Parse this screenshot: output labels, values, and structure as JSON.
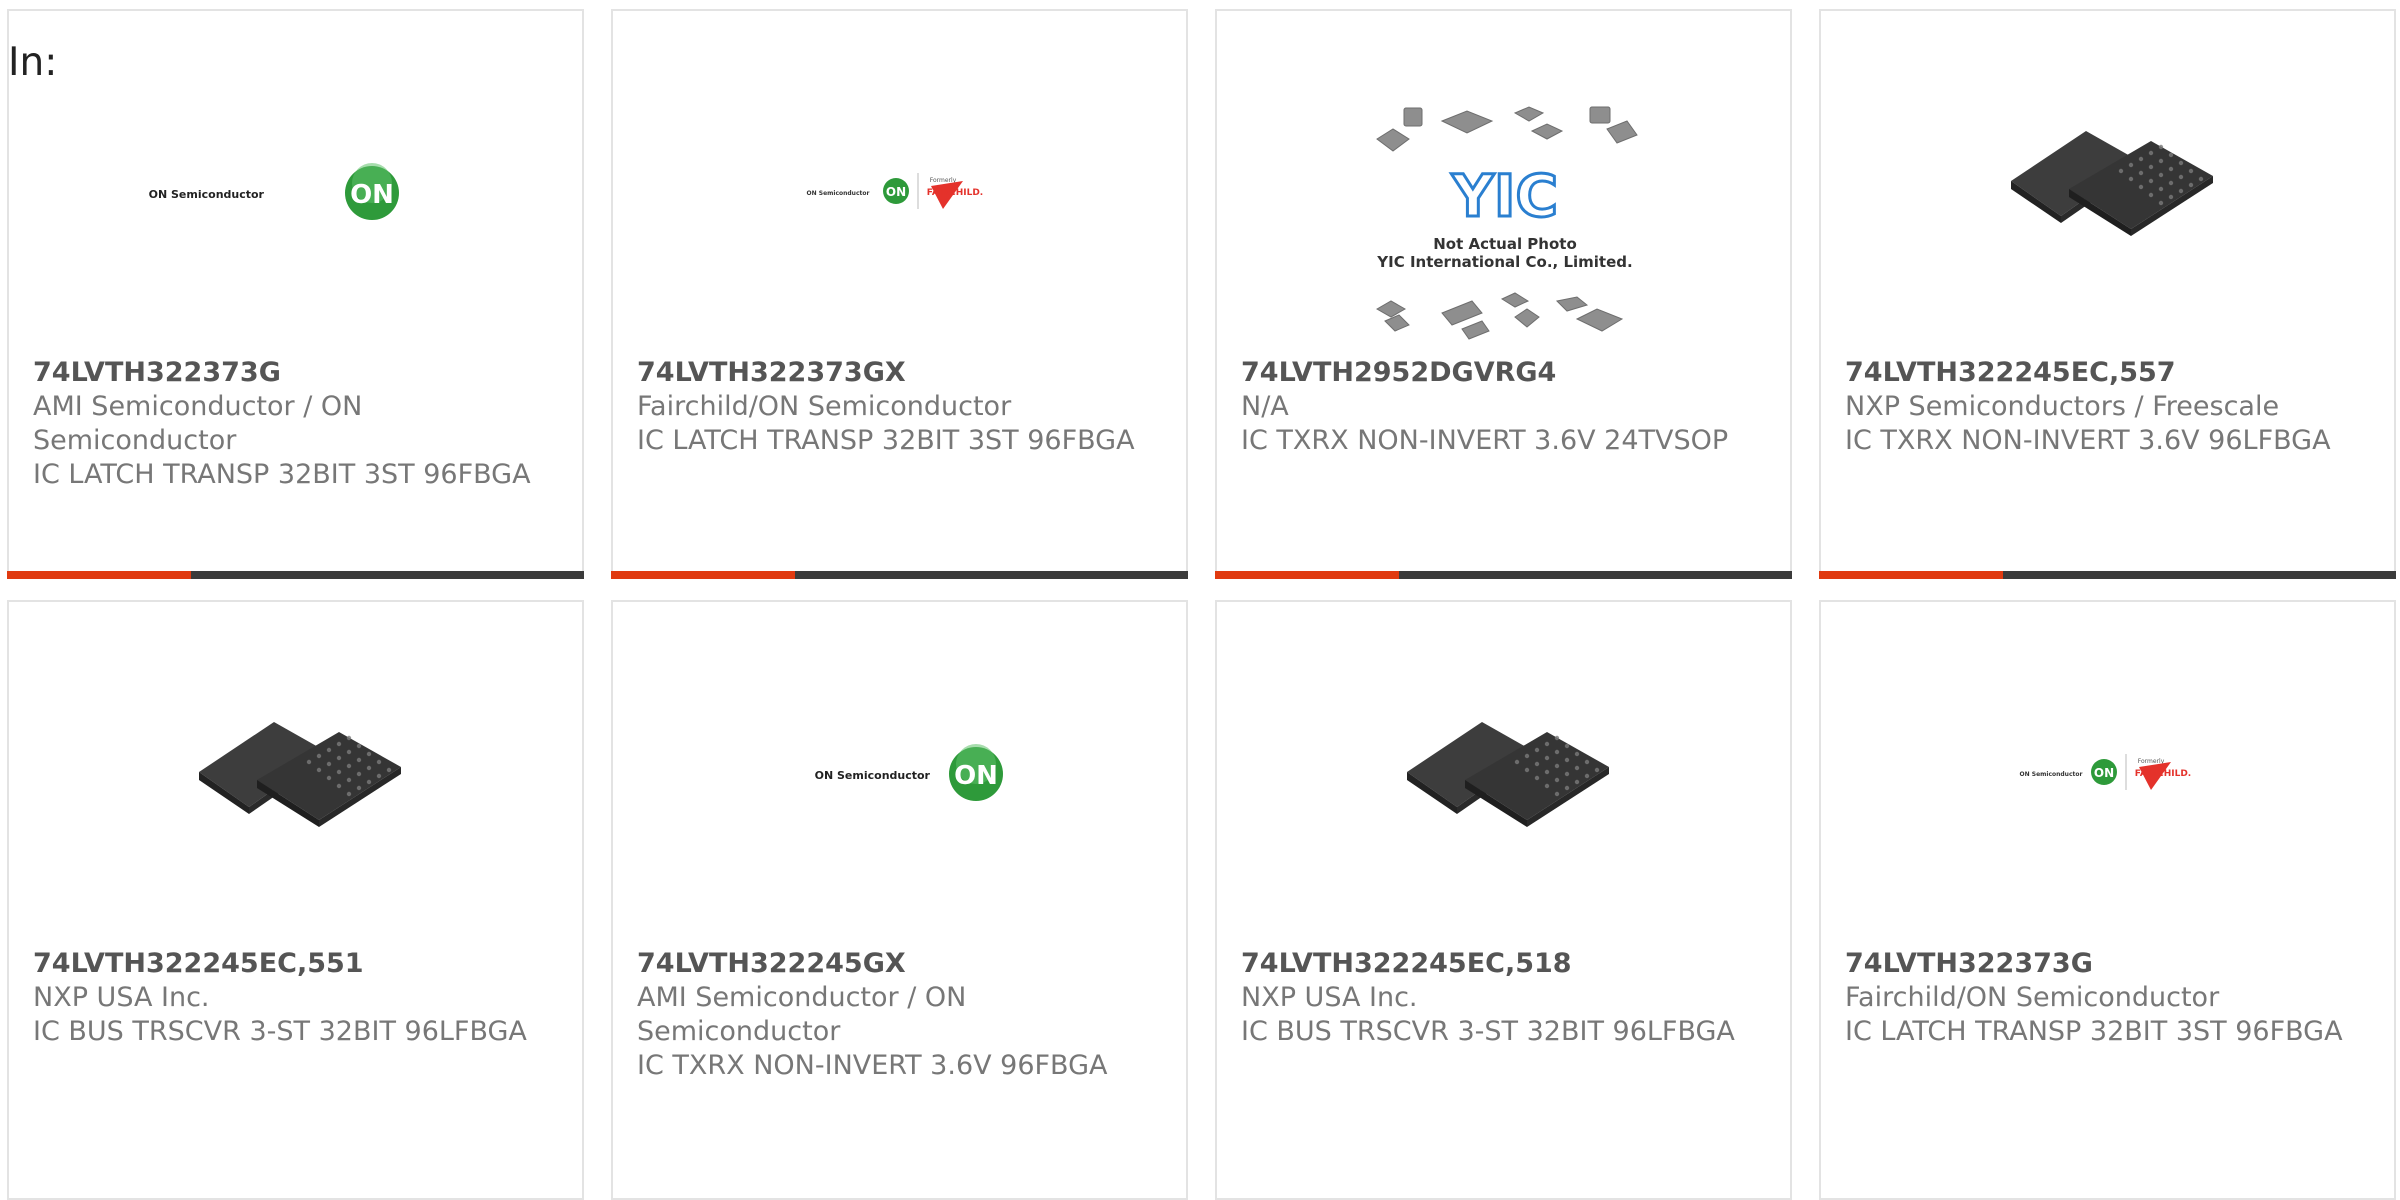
{
  "header": {
    "label": "In:"
  },
  "products": [
    {
      "part": "74LVTH322373G",
      "maker": "AMI Semiconductor / ON Semiconductor",
      "desc": "IC LATCH TRANSP 32BIT 3ST 96FBGA",
      "image": "on-semi-logo"
    },
    {
      "part": "74LVTH322373GX",
      "maker": "Fairchild/ON Semiconductor",
      "desc": "IC LATCH TRANSP 32BIT 3ST 96FBGA",
      "image": "on-fairchild-logo"
    },
    {
      "part": "74LVTH2952DGVRG4",
      "maker": "N/A",
      "desc": "IC TXRX NON-INVERT 3.6V 24TVSOP",
      "image": "not-actual-photo"
    },
    {
      "part": "74LVTH322245EC,557",
      "maker": "NXP Semiconductors / Freescale",
      "desc": "IC TXRX NON-INVERT 3.6V 96LFBGA",
      "image": "bga-chip"
    },
    {
      "part": "74LVTH322245EC,551",
      "maker": "NXP USA Inc.",
      "desc": "IC BUS TRSCVR 3-ST 32BIT 96LFBGA",
      "image": "bga-chip"
    },
    {
      "part": "74LVTH322245GX",
      "maker": "AMI Semiconductor / ON Semiconductor",
      "desc": "IC TXRX NON-INVERT 3.6V 96FBGA",
      "image": "on-semi-logo"
    },
    {
      "part": "74LVTH322245EC,518",
      "maker": "NXP USA Inc.",
      "desc": "IC BUS TRSCVR 3-ST 32BIT 96LFBGA",
      "image": "bga-chip"
    },
    {
      "part": "74LVTH322373G",
      "maker": "Fairchild/ON Semiconductor",
      "desc": "IC LATCH TRANSP 32BIT 3ST 96FBGA",
      "image": "on-fairchild-logo"
    }
  ],
  "logos": {
    "on_name": "ON Semiconductor",
    "on_mark": "ON",
    "formerly": "Formerly",
    "fairchild": "FAIRCHILD."
  },
  "placeholder": {
    "brand": "YIC",
    "line1": "Not Actual Photo",
    "line2": "YIC International Co., Limited."
  },
  "colors": {
    "accent": "#e03a10",
    "bar": "#3b3b3b",
    "on_green": "#2e9a3a",
    "fairchild_red": "#e4322b",
    "yic_blue": "#2a7fd0"
  }
}
